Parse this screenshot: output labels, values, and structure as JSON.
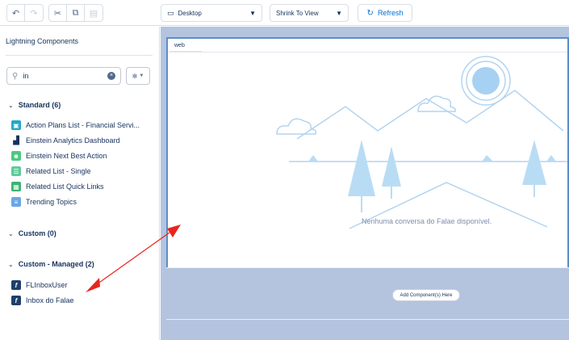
{
  "toolbar": {
    "undo_icon": "undo-icon",
    "redo_icon": "redo-icon",
    "cut_icon": "cut-icon",
    "copy_icon": "copy-icon",
    "paste_icon": "paste-icon",
    "device_select": "Desktop",
    "view_select": "Shrink To View",
    "refresh_label": "Refresh"
  },
  "panel": {
    "title": "Lightning Components",
    "search_value": "in",
    "sections": {
      "standard": "Standard (6)",
      "custom": "Custom (0)",
      "managed": "Custom - Managed (2)"
    },
    "standard_items": [
      "Action Plans List - Financial Servi...",
      "Einstein Analytics Dashboard",
      "Einstein Next Best Action",
      "Related List - Single",
      "Related List Quick Links",
      "Trending Topics"
    ],
    "managed_items": [
      "FLInboxUser",
      "Inbox do Falae"
    ]
  },
  "canvas": {
    "tab_label": "web",
    "empty_message": "Nenhuma conversa do Falae disponível.",
    "add_component": "Add Component(s) Here"
  },
  "colors": {
    "accent": "#0070d2",
    "canvas_bg": "#b4c4df",
    "frame_border": "#5a8ec9",
    "arrow": "#e8251f"
  }
}
